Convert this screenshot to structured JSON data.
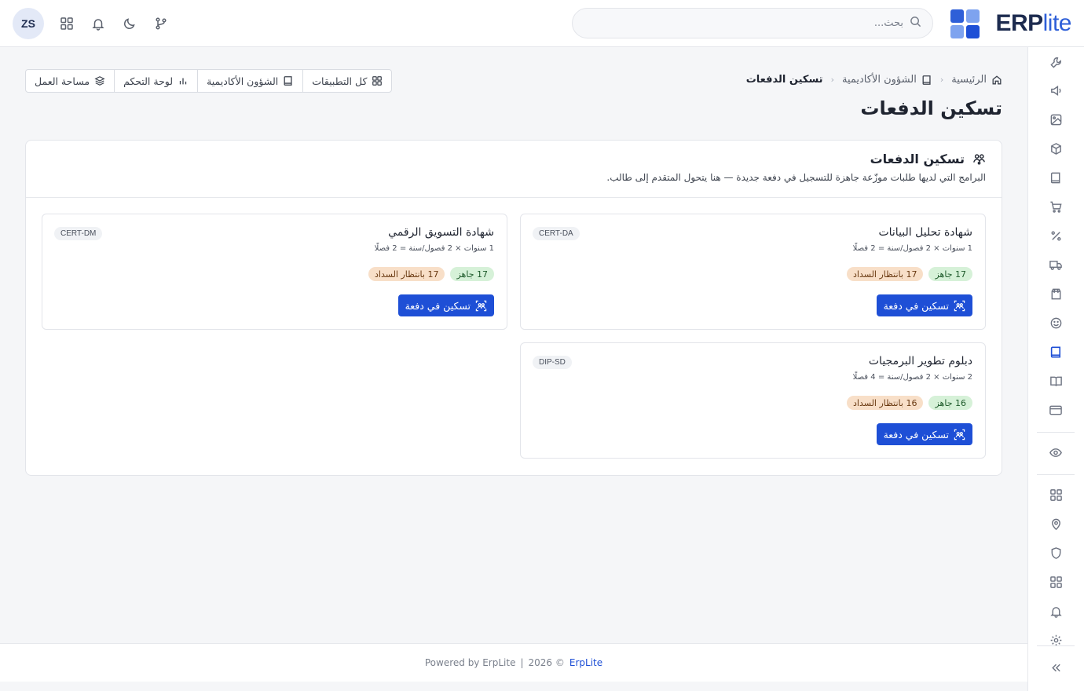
{
  "brand": {
    "name": "ERP",
    "suffix": "lite"
  },
  "search": {
    "placeholder": "بحث..."
  },
  "user": {
    "initials": "ZS"
  },
  "breadcrumb": [
    {
      "label": "الرئيسية"
    },
    {
      "label": "الشؤون الأكاديمية"
    },
    {
      "label": "تسكين الدفعات"
    }
  ],
  "page": {
    "title": "تسكين الدفعات"
  },
  "quick_links": [
    {
      "label": "مساحة العمل"
    },
    {
      "label": "لوحة التحكم"
    },
    {
      "label": "الشؤون الأكاديمية"
    },
    {
      "label": "كل التطبيقات"
    }
  ],
  "card": {
    "title": "تسكين الدفعات",
    "subtitle": "البرامج التي لديها طلبات موزّعة جاهزة للتسجيل في دفعة جديدة — هنا يتحول المتقدم إلى طالب."
  },
  "programs": [
    {
      "name": "شهادة تحليل البيانات",
      "code": "CERT-DA",
      "meta": "1 سنوات × 2 فصول/سنة = 2 فصلًا",
      "ready": "17 جاهز",
      "pending": "17 بانتظار السداد",
      "action": "تسكين في دفعة"
    },
    {
      "name": "شهادة التسويق الرقمي",
      "code": "CERT-DM",
      "meta": "1 سنوات × 2 فصول/سنة = 2 فصلًا",
      "ready": "17 جاهز",
      "pending": "17 بانتظار السداد",
      "action": "تسكين في دفعة"
    },
    {
      "name": "دبلوم تطوير البرمجيات",
      "code": "DIP-SD",
      "meta": "2 سنوات × 2 فصول/سنة = 4 فصلًا",
      "ready": "16 جاهز",
      "pending": "16 بانتظار السداد",
      "action": "تسكين في دفعة"
    }
  ],
  "footer": {
    "powered": "Powered by ErpLite",
    "divider": "|",
    "year": "2026 ©",
    "link": "ErpLite"
  },
  "colors": {
    "primary": "#1e4fd6",
    "ready_bg": "#d6f1d8",
    "pending_bg": "#f8dfc8",
    "brand_dark": "#1d2b4f"
  }
}
